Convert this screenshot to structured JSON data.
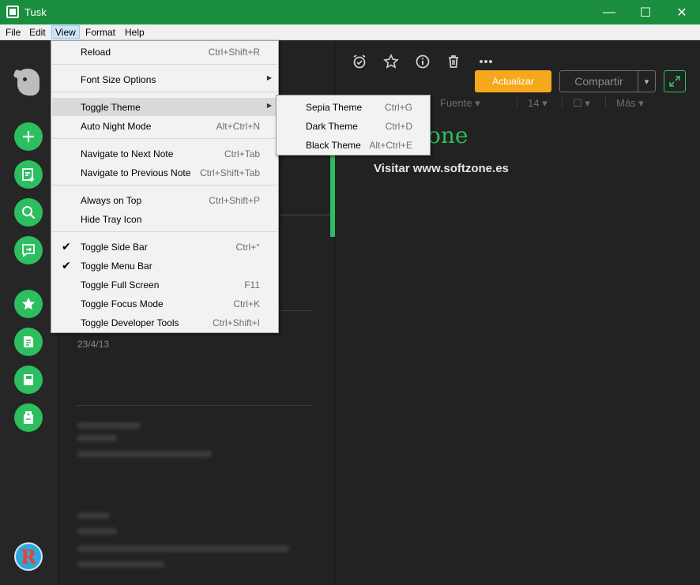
{
  "window": {
    "title": "Tusk",
    "minimize": "—",
    "maximize": "☐",
    "close": "✕"
  },
  "menubar": [
    "File",
    "Edit",
    "View",
    "Format",
    "Help"
  ],
  "view_menu": {
    "items": [
      {
        "label": "Reload",
        "accel": "Ctrl+Shift+R"
      },
      {
        "label": "Font Size Options",
        "accel": ""
      },
      {
        "label": "Toggle Theme",
        "accel": ""
      },
      {
        "label": "Auto Night Mode",
        "accel": "Alt+Ctrl+N"
      },
      {
        "label": "Navigate to Next Note",
        "accel": "Ctrl+Tab"
      },
      {
        "label": "Navigate to Previous Note",
        "accel": "Ctrl+Shift+Tab"
      },
      {
        "label": "Always on Top",
        "accel": "Ctrl+Shift+P"
      },
      {
        "label": "Hide Tray Icon",
        "accel": ""
      },
      {
        "label": "Toggle Side Bar",
        "accel": "Ctrl+°",
        "checked": true
      },
      {
        "label": "Toggle Menu Bar",
        "accel": "",
        "checked": true
      },
      {
        "label": "Toggle Full Screen",
        "accel": "F11"
      },
      {
        "label": "Toggle Focus Mode",
        "accel": "Ctrl+K"
      },
      {
        "label": "Toggle Developer Tools",
        "accel": "Ctrl+Shift+I"
      }
    ],
    "check_mark": "✔",
    "submenu_arrow": "▶"
  },
  "theme_submenu": [
    {
      "label": "Sepia Theme",
      "accel": "Ctrl+G"
    },
    {
      "label": "Dark Theme",
      "accel": "Ctrl+D"
    },
    {
      "label": "Black Theme",
      "accel": "Alt+Ctrl+E"
    }
  ],
  "notelist": {
    "date": "23/4/13"
  },
  "editor": {
    "update_button": "Actualizar",
    "share_button": "Compartir",
    "share_arrow": "▾",
    "format_bar": {
      "font": "Fuente ▾",
      "size": "14 ▾",
      "color": "☐ ▾",
      "more": "Más ▾"
    },
    "note_title_fragment": "one",
    "note_body": "Visitar www.softzone.es"
  },
  "avatar_letter": "R",
  "colors": {
    "accent_green": "#2dbe60",
    "titlebar_green": "#1b8d3f",
    "update_orange": "#f6a81d"
  },
  "icons": [
    "app-icon",
    "evernote-elephant-icon",
    "plus-icon",
    "new-note-icon",
    "search-icon",
    "work-chat-icon",
    "star-icon",
    "notes-icon",
    "notebook-icon",
    "tag-icon",
    "reminder-icon",
    "info-icon",
    "trash-icon",
    "more-icon",
    "expand-icon"
  ]
}
